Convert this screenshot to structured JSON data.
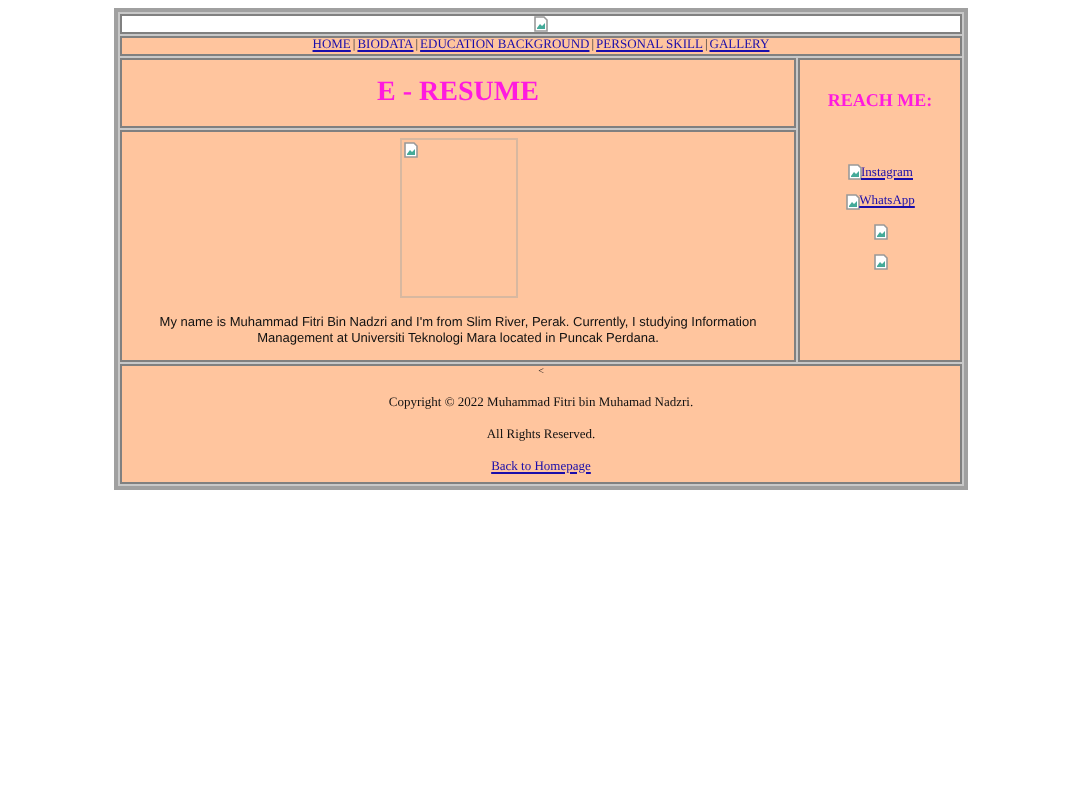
{
  "nav": {
    "separator": "|",
    "links": [
      {
        "label": "HOME "
      },
      {
        "label": "BIODATA"
      },
      {
        "label": "EDUCATION BACKGROUND"
      },
      {
        "label": "PERSONAL SKILL"
      },
      {
        "label": "GALLERY"
      }
    ]
  },
  "title": "E - RESUME",
  "intro": "My name is Muhammad Fitri Bin Nadzri and I'm from Slim River, Perak. Currently, I studying Information Management at Universiti Teknologi Mara located in Puncak Perdana.",
  "contact": {
    "heading": "REACH ME:",
    "items": [
      {
        "kind": "link",
        "label": "Instagram"
      },
      {
        "kind": "link",
        "label": "WhatsApp"
      },
      {
        "kind": "image"
      },
      {
        "kind": "image"
      }
    ]
  },
  "footer": {
    "mark": "<",
    "copyright": "Copyright © 2022 Muhammad Fitri bin Muhamad Nadzri.",
    "rights": "All Rights Reserved.",
    "link": "Back to Homepage"
  }
}
